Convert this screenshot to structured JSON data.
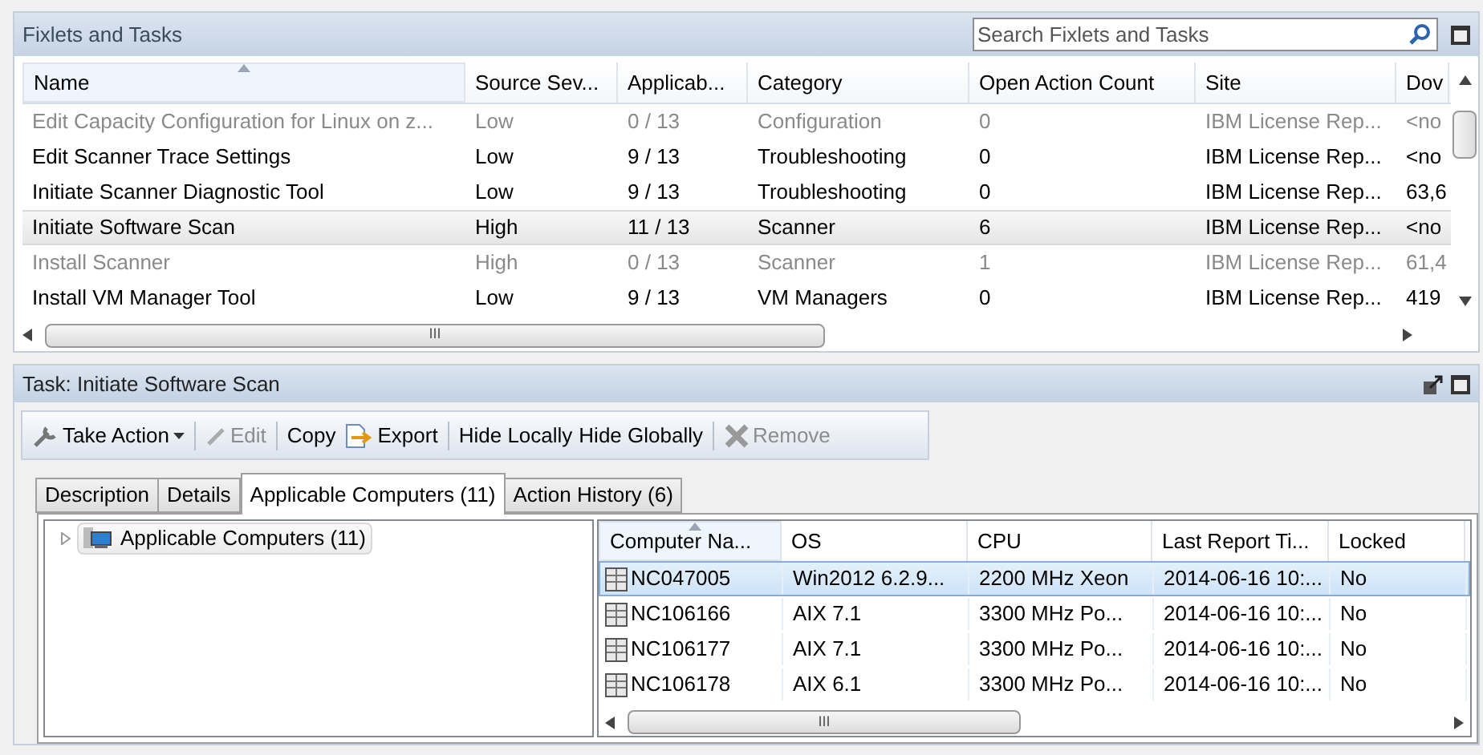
{
  "fixlets": {
    "title": "Fixlets and Tasks",
    "search": {
      "placeholder": "Search Fixlets and Tasks"
    },
    "columns": [
      "Name",
      "Source Sev...",
      "Applicab...",
      "Category",
      "Open Action Count",
      "Site",
      "Dov"
    ],
    "rows": [
      {
        "cells": [
          "Edit Capacity Configuration for Linux on z...",
          "Low",
          "0 / 13",
          "Configuration",
          "0",
          "IBM License Rep...",
          "<no"
        ],
        "disabled": true,
        "selected": false
      },
      {
        "cells": [
          "Edit Scanner Trace Settings",
          "Low",
          "9 / 13",
          "Troubleshooting",
          "0",
          "IBM License Rep...",
          "<no"
        ],
        "disabled": false,
        "selected": false
      },
      {
        "cells": [
          "Initiate Scanner Diagnostic Tool",
          "Low",
          "9 / 13",
          "Troubleshooting",
          "0",
          "IBM License Rep...",
          "63,6"
        ],
        "disabled": false,
        "selected": false
      },
      {
        "cells": [
          "Initiate Software Scan",
          "High",
          "11 / 13",
          "Scanner",
          "6",
          "IBM License Rep...",
          "<no"
        ],
        "disabled": false,
        "selected": true
      },
      {
        "cells": [
          "Install Scanner",
          "High",
          "0 / 13",
          "Scanner",
          "1",
          "IBM License Rep...",
          "61,4"
        ],
        "disabled": true,
        "selected": false
      },
      {
        "cells": [
          "Install VM Manager Tool",
          "Low",
          "9 / 13",
          "VM Managers",
          "0",
          "IBM License Rep...",
          "419"
        ],
        "disabled": false,
        "selected": false
      }
    ],
    "scroll_label": "III"
  },
  "task": {
    "title": "Task: Initiate Software Scan",
    "toolbar": [
      {
        "kind": "action",
        "label": "Take Action",
        "disabled": false
      },
      {
        "kind": "edit",
        "label": "Edit",
        "disabled": true
      },
      {
        "kind": "plain",
        "label": "Copy",
        "disabled": false
      },
      {
        "kind": "export",
        "label": "Export",
        "disabled": false
      },
      {
        "kind": "plain",
        "label": "Hide Locally",
        "disabled": false
      },
      {
        "kind": "plain",
        "label": "Hide Globally",
        "disabled": false
      },
      {
        "kind": "remove",
        "label": "Remove",
        "disabled": true
      }
    ],
    "tabs": [
      {
        "label": "Description",
        "selected": false
      },
      {
        "label": "Details",
        "selected": false
      },
      {
        "label": "Applicable Computers (11)",
        "selected": true
      },
      {
        "label": "Action History (6)",
        "selected": false
      }
    ],
    "tree": [
      {
        "label": "Applicable Computers (11)",
        "expanded": false
      }
    ],
    "columns": [
      "Computer Na...",
      "OS",
      "CPU",
      "Last Report Ti...",
      "Locked"
    ],
    "rows": [
      {
        "cells": [
          "NC047005",
          "Win2012 6.2.9...",
          "2200 MHz Xeon",
          "2014-06-16 10:...",
          "No"
        ],
        "selected": true
      },
      {
        "cells": [
          "NC106166",
          "AIX 7.1",
          "3300 MHz Po...",
          "2014-06-16 10:...",
          "No"
        ],
        "selected": false
      },
      {
        "cells": [
          "NC106177",
          "AIX 7.1",
          "3300 MHz Po...",
          "2014-06-16 10:...",
          "No"
        ],
        "selected": false
      },
      {
        "cells": [
          "NC106178",
          "AIX 6.1",
          "3300 MHz Po...",
          "2014-06-16 10:...",
          "No"
        ],
        "selected": false
      }
    ],
    "scroll_label": "III"
  }
}
